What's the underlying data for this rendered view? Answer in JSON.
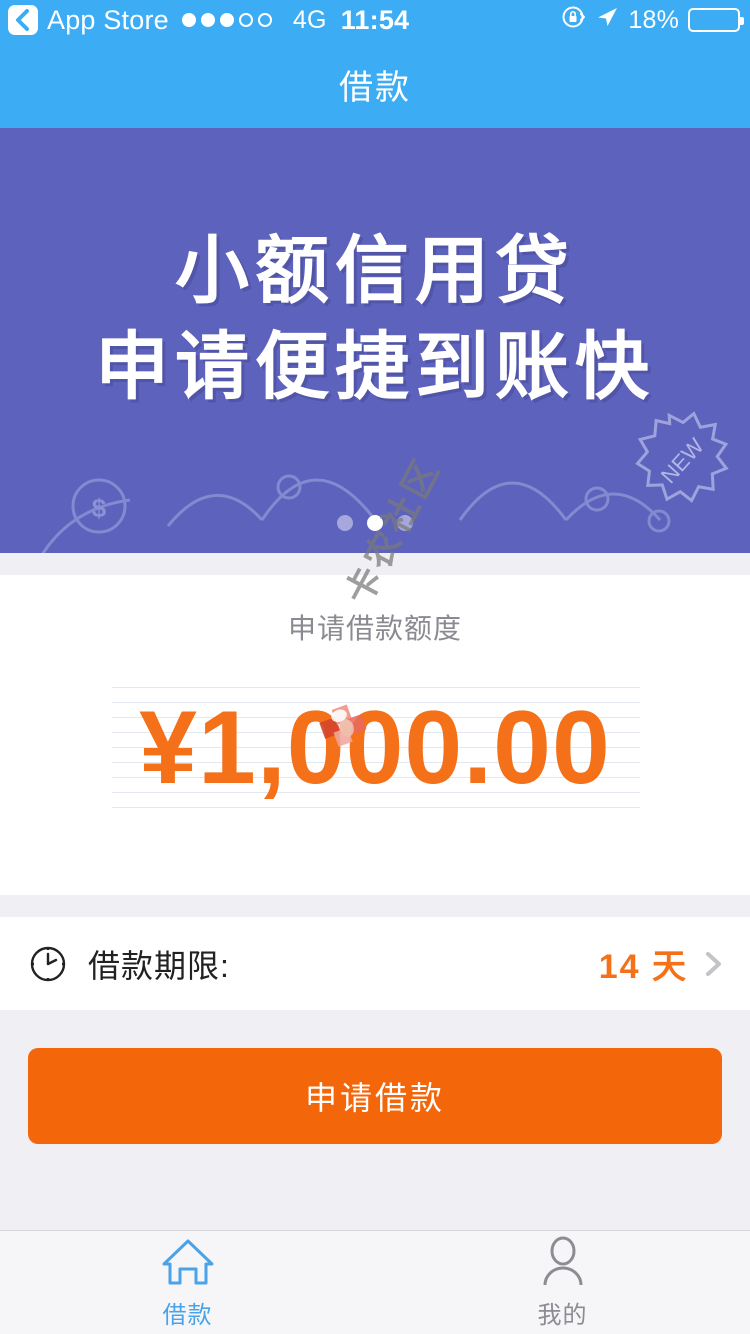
{
  "status_bar": {
    "back_label": "App Store",
    "back_icon": "chevron-left-icon",
    "signal_dots_filled": 3,
    "signal_dots_total": 5,
    "network": "4G",
    "time": "11:54",
    "rotation_lock_icon": "rotation-lock-icon",
    "location_icon": "location-arrow-icon",
    "battery_percent": "18%",
    "battery_level": 18,
    "battery_color": "#fc3b30",
    "bar_color": "#3cadf5"
  },
  "nav": {
    "title": "借款"
  },
  "banner": {
    "background_color": "#5d62bd",
    "line1": "小额信用贷",
    "line2": "申请便捷到账快",
    "badge_text": "NEW",
    "coin_icon": "dollar-coin-icon",
    "carousel_dots": 3,
    "carousel_active_index": 1
  },
  "amount_card": {
    "label": "申请借款额度",
    "value": "¥1,000.00",
    "currency_symbol": "¥",
    "amount": 1000.0,
    "value_color": "#f4711a",
    "watermark": "卡农社区"
  },
  "term_row": {
    "icon": "clock-icon",
    "label": "借款期限:",
    "value": "14 天",
    "value_color": "#f4711a",
    "chevron_icon": "chevron-right-icon"
  },
  "apply": {
    "label": "申请借款",
    "color": "#f4660a"
  },
  "tab_bar": {
    "items": [
      {
        "label": "借款",
        "icon": "home-icon",
        "active": true,
        "color": "#4aa3e8"
      },
      {
        "label": "我的",
        "icon": "person-icon",
        "active": false,
        "color": "#8c8c92"
      }
    ]
  }
}
